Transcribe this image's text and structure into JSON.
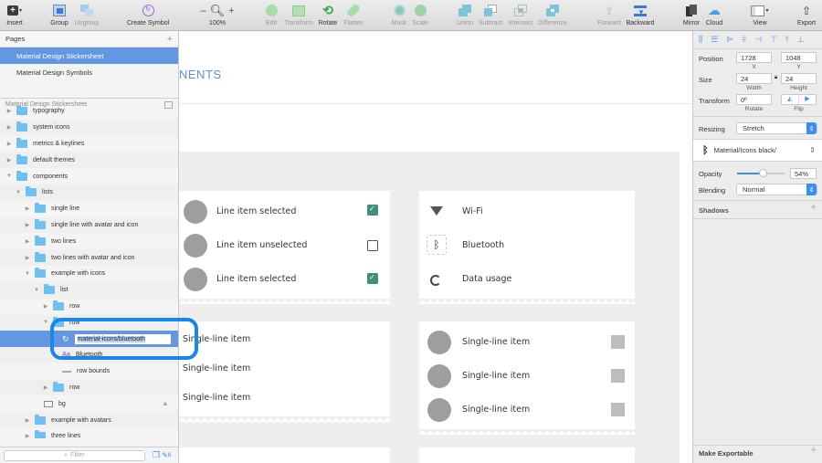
{
  "toolbar": {
    "insert": "Insert",
    "group": "Group",
    "ungroup": "Ungroup",
    "create_symbol": "Create Symbol",
    "zoom_minus": "–",
    "zoom_plus": "+",
    "zoom_level": "100%",
    "edit": "Edit",
    "transform": "Transform",
    "rotate": "Rotate",
    "flatten": "Flatten",
    "mask": "Mask",
    "scale": "Scale",
    "union": "Union",
    "subtract": "Subtract",
    "intersect": "Intersect",
    "difference": "Difference",
    "forward": "Forward",
    "backward": "Backward",
    "mirror": "Mirror",
    "cloud": "Cloud",
    "view": "View",
    "export": "Export"
  },
  "pages": {
    "header": "Pages",
    "add": "+",
    "items": [
      {
        "label": "Material Design Stickersheet",
        "selected": true
      },
      {
        "label": "Material Design Symbols",
        "selected": false
      }
    ]
  },
  "layers": {
    "header": "Material Design Stickersheet",
    "items": [
      {
        "label": "typography",
        "depth": 0,
        "type": "folder",
        "expanded": false
      },
      {
        "label": "system icons",
        "depth": 0,
        "type": "folder",
        "expanded": false
      },
      {
        "label": "metrics & keylines",
        "depth": 0,
        "type": "folder",
        "expanded": false
      },
      {
        "label": "default themes",
        "depth": 0,
        "type": "folder",
        "expanded": false
      },
      {
        "label": "components",
        "depth": 0,
        "type": "folder",
        "expanded": true
      },
      {
        "label": "lists",
        "depth": 1,
        "type": "folder",
        "expanded": true
      },
      {
        "label": "single line",
        "depth": 2,
        "type": "folder",
        "expanded": false
      },
      {
        "label": "single line with avatar and icon",
        "depth": 2,
        "type": "folder",
        "expanded": false
      },
      {
        "label": "two lines",
        "depth": 2,
        "type": "folder",
        "expanded": false
      },
      {
        "label": "two lines with avatar and icon",
        "depth": 2,
        "type": "folder",
        "expanded": false
      },
      {
        "label": "example with icons",
        "depth": 2,
        "type": "folder",
        "expanded": true
      },
      {
        "label": "list",
        "depth": 3,
        "type": "folder",
        "expanded": true
      },
      {
        "label": "row",
        "depth": 4,
        "type": "folder",
        "expanded": false
      },
      {
        "label": "row",
        "depth": 4,
        "type": "folder",
        "expanded": true
      },
      {
        "label": "material-icons/bluetooth",
        "depth": 5,
        "type": "symbol",
        "selected": true,
        "editing": true
      },
      {
        "label": "Bluetooth",
        "depth": 5,
        "type": "text"
      },
      {
        "label": "row bounds",
        "depth": 5,
        "type": "line"
      },
      {
        "label": "row",
        "depth": 4,
        "type": "folder",
        "expanded": false
      },
      {
        "label": "bg",
        "depth": 3,
        "type": "rect",
        "locked": true
      },
      {
        "label": "example with avatars",
        "depth": 2,
        "type": "folder",
        "expanded": false
      },
      {
        "label": "three lines",
        "depth": 2,
        "type": "folder",
        "expanded": false
      }
    ],
    "filter_placeholder": "Filter",
    "count": "8"
  },
  "canvas": {
    "artboard_title": "NENTS",
    "card1": [
      {
        "label": "Line item selected",
        "checked": true
      },
      {
        "label": "Line item unselected",
        "checked": false
      },
      {
        "label": "Line item selected",
        "checked": true
      }
    ],
    "card2": [
      {
        "label": "Wi-Fi",
        "icon": "wifi-icon"
      },
      {
        "label": "Bluetooth",
        "icon": "bluetooth-icon"
      },
      {
        "label": "Data usage",
        "icon": "data-usage-icon"
      }
    ],
    "card3": [
      "Single-line item",
      "Single-line item",
      "Single-line item"
    ],
    "card4": [
      "Single-line item",
      "Single-line item",
      "Single-line item"
    ]
  },
  "inspector": {
    "position_label": "Position",
    "x": "1728",
    "y": "1048",
    "x_label": "X",
    "y_label": "Y",
    "size_label": "Size",
    "width": "24",
    "height": "24",
    "width_label": "Width",
    "height_label": "Height",
    "transform_label": "Transform",
    "rotate": "0º",
    "rotate_label": "Rotate",
    "flip_label": "Flip",
    "resizing_label": "Resizing",
    "resizing_value": "Stretch",
    "symbol_name": "Material/Icons black/",
    "opacity_label": "Opacity",
    "opacity_value": "54%",
    "opacity_fraction": 0.54,
    "blending_label": "Blending",
    "blending_value": "Normal",
    "shadows_label": "Shadows",
    "make_exportable": "Make Exportable"
  },
  "colors": {
    "selection": "#6596e0",
    "accent": "#3b8ef0",
    "checkbox": "#3f8f7a",
    "highlight_ring": "#1a86e8",
    "title": "#5a8fdb"
  }
}
